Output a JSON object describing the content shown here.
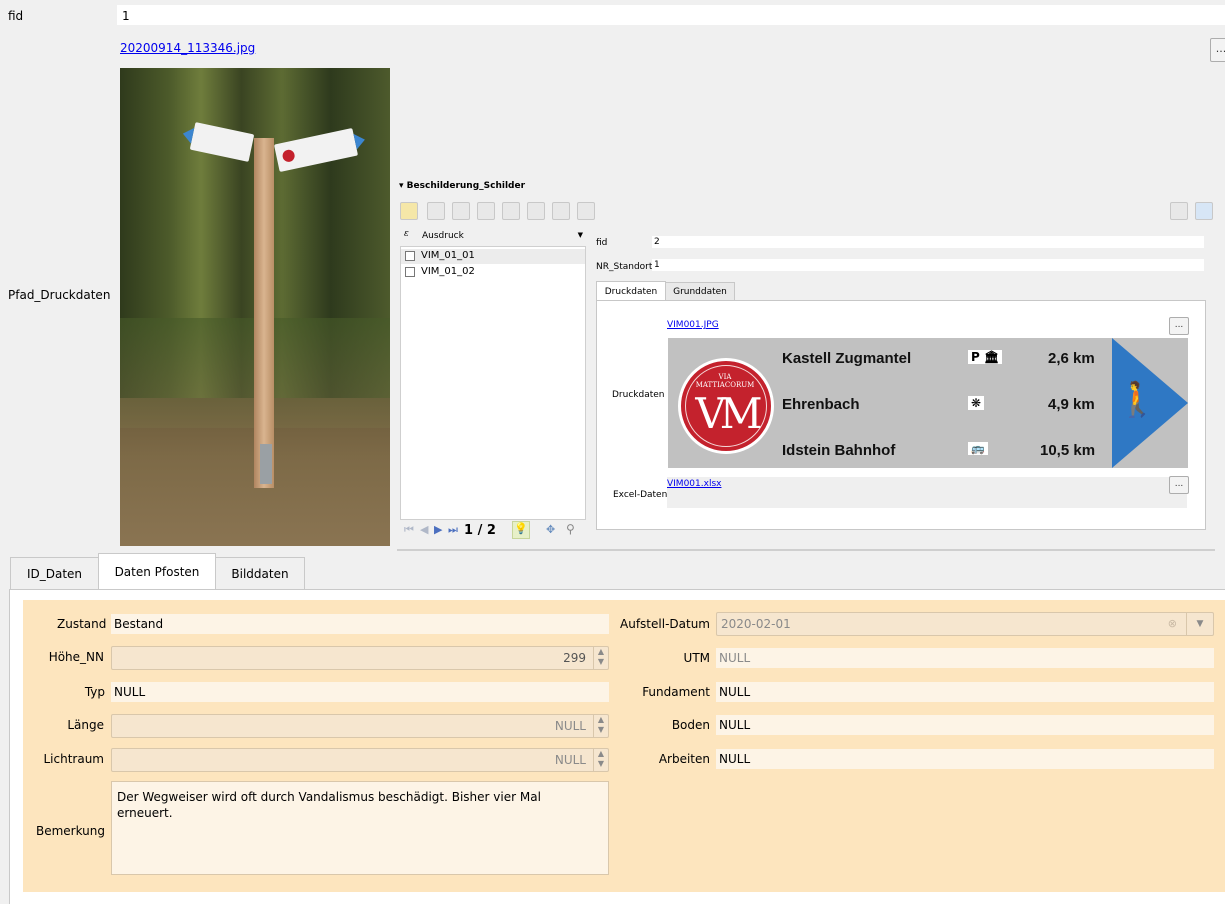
{
  "fid": {
    "label": "fid",
    "value": "1"
  },
  "pfad": {
    "label": "Pfad_Druckdaten",
    "file_link": "20200914_113346.jpg",
    "browse_button": "...",
    "photo_sign_left": "Idstein Bahnhof",
    "photo_sign_right": "Kastell Zugmantel"
  },
  "subform": {
    "title": "Beschilderung_Schilder",
    "expression_label": "Ausdruck",
    "expression_icon": "epsilon-icon",
    "list_items": [
      "VIM_01_01",
      "VIM_01_02"
    ],
    "pager": "1 / 2",
    "fid_label": "fid",
    "fid_value": "2",
    "nr_label": "NR_Standort",
    "nr_value": "1",
    "tabs": [
      "Druckdaten",
      "Grunddaten"
    ],
    "druck_label": "Druckdaten",
    "druck_link": "VIM001.JPG",
    "excel_label": "Excel-Daten",
    "excel_link": "VIM001.xlsx",
    "browse": "...",
    "sign": {
      "logo_text": "VIA MATTIACORUM",
      "logo_letters": "VM",
      "rows": [
        {
          "dest": "Kastell Zugmantel",
          "icons": "P 🏛",
          "dist": "2,6 km"
        },
        {
          "dest": "Ehrenbach",
          "icons": "❋",
          "dist": "4,9 km"
        },
        {
          "dest": "Idstein Bahnhof",
          "icons": "🚌",
          "dist": "10,5 km"
        }
      ]
    }
  },
  "main_tabs": [
    "ID_Daten",
    "Daten Pfosten",
    "Bilddaten"
  ],
  "form": {
    "zustand_label": "Zustand",
    "zustand_value": "Bestand",
    "hoehe_label": "Höhe_NN",
    "hoehe_value": "299",
    "typ_label": "Typ",
    "typ_value": "NULL",
    "laenge_label": "Länge",
    "laenge_value": "NULL",
    "lichtraum_label": "Lichtraum",
    "lichtraum_value": "NULL",
    "bemerkung_label": "Bemerkung",
    "bemerkung_value": "Der Wegweiser wird oft durch Vandalismus beschädigt. Bisher vier Mal erneuert.",
    "datum_label": "Aufstell-Datum",
    "datum_value": "2020-02-01",
    "utm_label": "UTM",
    "utm_value": "NULL",
    "fundament_label": "Fundament",
    "fundament_value": "NULL",
    "boden_label": "Boden",
    "boden_value": "NULL",
    "arbeiten_label": "Arbeiten",
    "arbeiten_value": "NULL"
  },
  "colors": {
    "panel": "#fde5be",
    "sign_blue": "#2f78c4",
    "logo_red": "#c4222d"
  }
}
